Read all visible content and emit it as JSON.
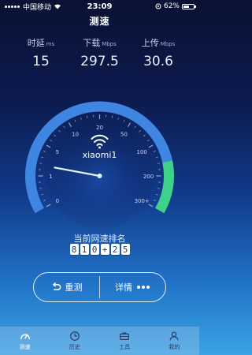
{
  "status": {
    "carrier": "中国移动",
    "time": "23:09",
    "battery": "62%",
    "battery_level": 0.62
  },
  "title": "测速",
  "metrics": [
    {
      "label": "时延",
      "unit": "ms",
      "value": "15"
    },
    {
      "label": "下载",
      "unit": "Mbps",
      "value": "297.5"
    },
    {
      "label": "上传",
      "unit": "Mbps",
      "value": "30.6"
    }
  ],
  "gauge": {
    "ssid": "xiaomi1",
    "scale_labels": [
      "0",
      "1",
      "5",
      "10",
      "20",
      "50",
      "100",
      "200",
      "300+"
    ],
    "needle_value": "1.5",
    "colors": {
      "track": "#3f86e2",
      "upload": "#3fd08a"
    }
  },
  "rank": {
    "title": "当前网速排名",
    "digits": [
      "8",
      "1",
      "0",
      "+",
      "2",
      "5"
    ]
  },
  "actions": {
    "retest": "重测",
    "details": "详情"
  },
  "tabs": [
    {
      "label": "测速",
      "icon": "speedometer-icon"
    },
    {
      "label": "历史",
      "icon": "clock-icon"
    },
    {
      "label": "工具",
      "icon": "toolbox-icon"
    },
    {
      "label": "我的",
      "icon": "user-icon"
    }
  ]
}
